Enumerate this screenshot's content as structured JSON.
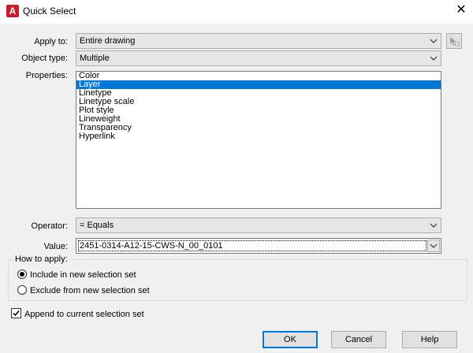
{
  "window": {
    "title": "Quick Select",
    "app_icon_letter": "A",
    "app_icon_color": "#c81e2a",
    "close_glyph": "✕"
  },
  "apply_to": {
    "label": "Apply to:",
    "value": "Entire drawing"
  },
  "object_type": {
    "label": "Object type:",
    "value": "Multiple"
  },
  "properties": {
    "label": "Properties:",
    "items": [
      "Color",
      "Layer",
      "Linetype",
      "Linetype scale",
      "Plot style",
      "Lineweight",
      "Transparency",
      "Hyperlink"
    ],
    "selected": "Layer"
  },
  "operator": {
    "label": "Operator:",
    "value": "= Equals"
  },
  "value": {
    "label": "Value:",
    "value": "2451-0314-A12-15-CWS-N_00_0101"
  },
  "how_to_apply": {
    "label": "How to apply:",
    "include": "Include in new selection set",
    "exclude": "Exclude from new selection set",
    "selected": "include"
  },
  "append": {
    "label": "Append to current selection set",
    "checked": true
  },
  "buttons": {
    "ok": "OK",
    "cancel": "Cancel",
    "help": "Help"
  },
  "colors": {
    "selection": "#0078d7",
    "focus_border": "#0078d7"
  },
  "icons": {
    "dropdown": "chevron-down-icon",
    "select_objects": "select-objects-icon"
  }
}
